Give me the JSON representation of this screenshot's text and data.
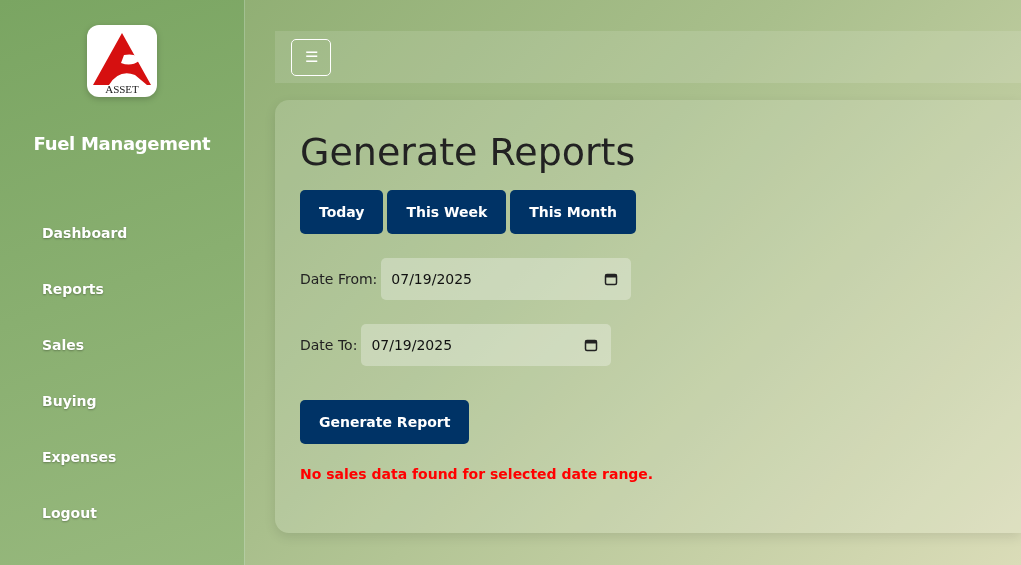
{
  "sidebar": {
    "logo_text": "ASSET",
    "title": "Fuel Management",
    "items": [
      {
        "label": "Dashboard"
      },
      {
        "label": "Reports"
      },
      {
        "label": "Sales"
      },
      {
        "label": "Buying"
      },
      {
        "label": "Expenses"
      },
      {
        "label": "Logout"
      }
    ]
  },
  "topbar": {
    "menu_button": "☰"
  },
  "card": {
    "title": "Generate Reports",
    "range_buttons": [
      "Today",
      "This Week",
      "This Month"
    ],
    "fields": [
      {
        "label": "Date From:",
        "value": "07/19/2025"
      },
      {
        "label": "Date To:",
        "value": "07/19/2025"
      }
    ],
    "submit": "Generate Report",
    "message": "No sales data found for selected date range."
  }
}
